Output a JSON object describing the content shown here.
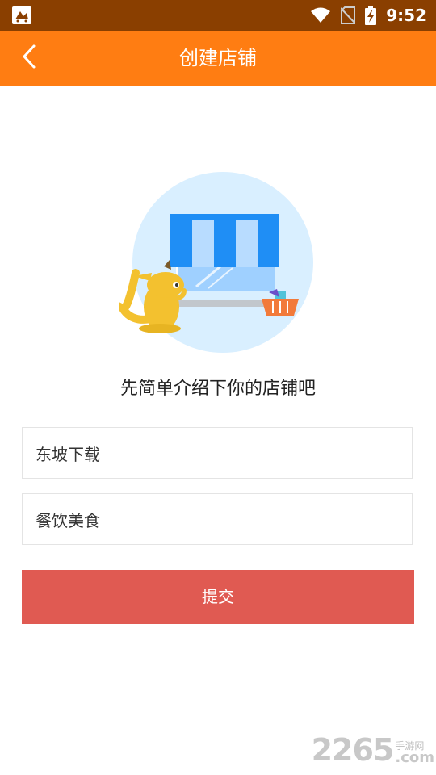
{
  "status_bar": {
    "time": "9:52"
  },
  "nav": {
    "title": "创建店铺"
  },
  "content": {
    "subtitle": "先简单介绍下你的店铺吧",
    "shop_name_field": {
      "value": "东坡下载"
    },
    "category_field": {
      "value": "餐饮美食"
    },
    "submit_label": "提交"
  },
  "watermark": {
    "number": "2265",
    "cn": "手游网",
    "suffix": ".com"
  },
  "colors": {
    "status_bar": "#8a3f00",
    "nav_bar": "#ff7d12",
    "submit": "#e05a52",
    "illustration_circle": "#d9efff",
    "awning_blue": "#1f8ef5"
  }
}
